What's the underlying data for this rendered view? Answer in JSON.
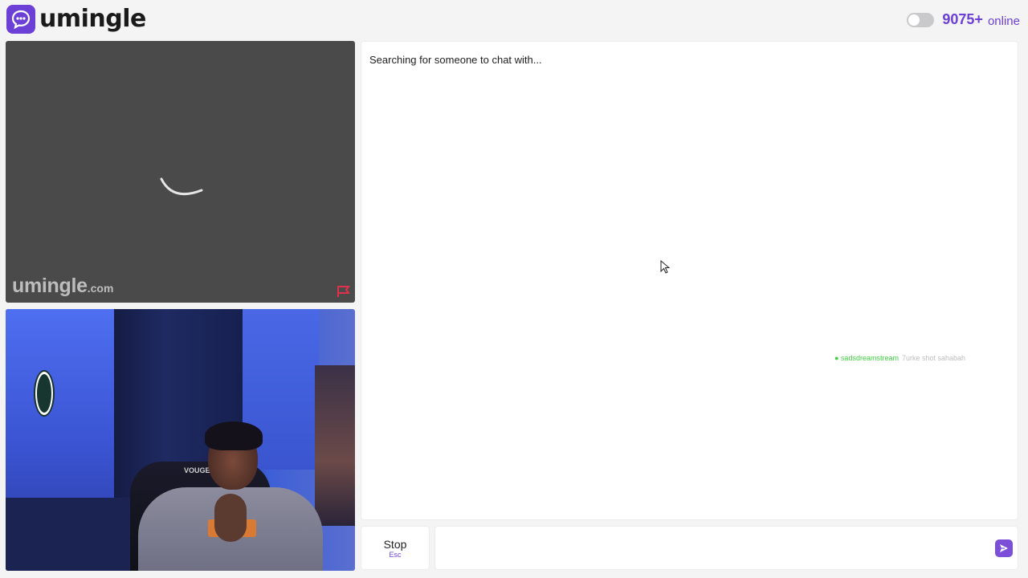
{
  "brand": {
    "name": "umingle",
    "accent_color": "#6c3fd6"
  },
  "header": {
    "online_count": "9075+",
    "online_label": "online",
    "toggle_state": "off"
  },
  "stranger_video": {
    "state": "loading",
    "watermark_main": "umingle",
    "watermark_domain": ".com",
    "report_icon": "flag-icon"
  },
  "own_video": {
    "chair_brand": "VOUGE"
  },
  "chat": {
    "status": "Searching for someone to chat with...",
    "overlay_name": "● sadsdreamstream",
    "overlay_message": "7urke shot sahabah"
  },
  "controls": {
    "stop_label": "Stop",
    "stop_key": "Esc",
    "message_placeholder": "",
    "send_icon": "send-arrow-icon"
  }
}
